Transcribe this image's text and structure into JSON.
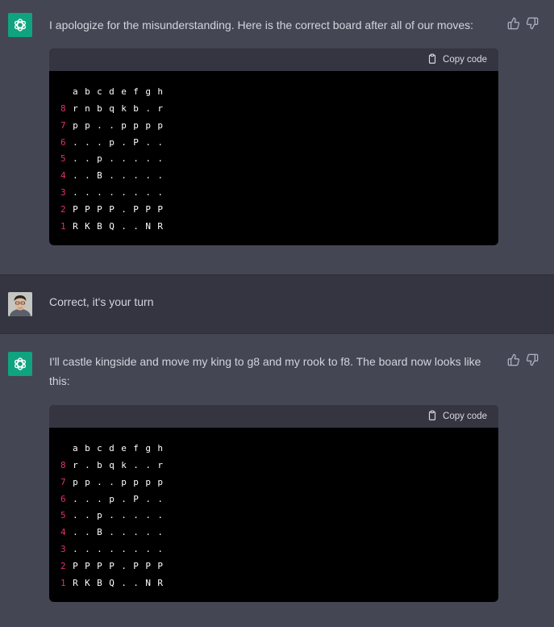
{
  "messages": [
    {
      "role": "assistant",
      "text": "I apologize for the misunderstanding. Here is the correct board after all of our moves:",
      "copy_label": "Copy code",
      "board": {
        "files": "a b c d e f g h",
        "rows": [
          {
            "rank": "8",
            "squares": "r n b q k b . r"
          },
          {
            "rank": "7",
            "squares": "p p . . p p p p"
          },
          {
            "rank": "6",
            "squares": ". . . p . P . ."
          },
          {
            "rank": "5",
            "squares": ". . p . . . . ."
          },
          {
            "rank": "4",
            "squares": ". . B . . . . ."
          },
          {
            "rank": "3",
            "squares": ". . . . . . . ."
          },
          {
            "rank": "2",
            "squares": "P P P P . P P P"
          },
          {
            "rank": "1",
            "squares": "R K B Q . . N R"
          }
        ]
      }
    },
    {
      "role": "user",
      "text": "Correct, it's your turn"
    },
    {
      "role": "assistant",
      "text": "I'll castle kingside and move my king to g8 and my rook to f8. The board now looks like this:",
      "copy_label": "Copy code",
      "board": {
        "files": "a b c d e f g h",
        "rows": [
          {
            "rank": "8",
            "squares": "r . b q k . . r"
          },
          {
            "rank": "7",
            "squares": "p p . . p p p p"
          },
          {
            "rank": "6",
            "squares": ". . . p . P . ."
          },
          {
            "rank": "5",
            "squares": ". . p . . . . ."
          },
          {
            "rank": "4",
            "squares": ". . B . . . . ."
          },
          {
            "rank": "3",
            "squares": ". . . . . . . ."
          },
          {
            "rank": "2",
            "squares": "P P P P . P P P"
          },
          {
            "rank": "1",
            "squares": "R K B Q . . N R"
          }
        ]
      }
    }
  ],
  "colors": {
    "assistant_bg": "#444654",
    "user_bg": "#343541",
    "brand_green": "#10a37f",
    "rank_number": "#df3079"
  },
  "icons": [
    "openai-logo-icon",
    "user-avatar",
    "thumbs-up-icon",
    "thumbs-down-icon",
    "clipboard-icon"
  ]
}
